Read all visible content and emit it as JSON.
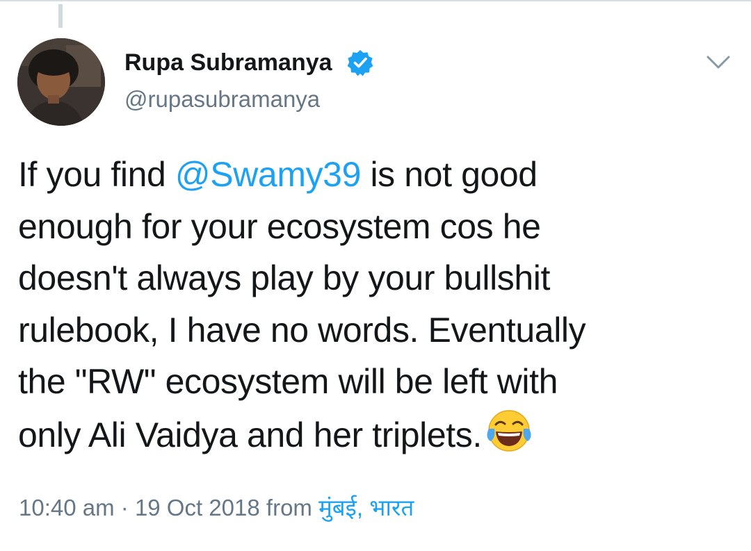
{
  "tweet": {
    "author": {
      "display_name": "Rupa Subramanya",
      "handle": "@rupasubramanya",
      "verified": true
    },
    "text_lines": [
      {
        "before": "If you find ",
        "mention": "@Swamy39",
        "after": " is not good"
      },
      {
        "text": "enough for your ecosystem cos he"
      },
      {
        "text": "doesn't always play by your bullshit"
      },
      {
        "text": "rulebook, I have no words. Eventually"
      },
      {
        "text": "the \"RW\" ecosystem will be left with"
      },
      {
        "text": "only Ali Vaidya and her triplets."
      }
    ],
    "emoji": "face-with-tears-of-joy",
    "time": "10:40 am",
    "separator": "·",
    "date": "19 Oct 2018",
    "from_label": "from",
    "location": "मुंबई, भारत"
  },
  "colors": {
    "link": "#1da1f2",
    "text": "#14171a",
    "muted": "#657786"
  },
  "icons": {
    "verified": "verified-badge-icon",
    "menu": "chevron-down-icon"
  }
}
